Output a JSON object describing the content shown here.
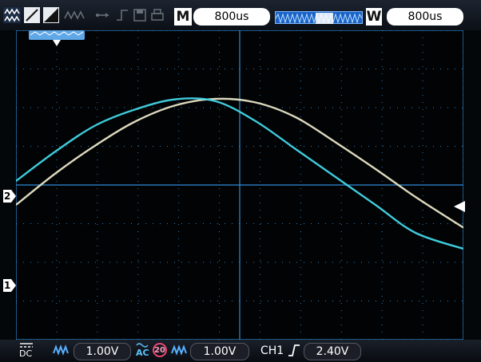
{
  "top": {
    "time_base_letter": "M",
    "time_base_value": "800us",
    "window_letter": "W",
    "window_value": "800us"
  },
  "channels": {
    "ch1_marker": "1",
    "ch2_marker": "2"
  },
  "bottom": {
    "ch1_coupling": "DC",
    "ch1_scale": "1.00V",
    "ch2_coupling_ac": "AC",
    "ch2_bw_label": "20",
    "ch2_scale": "1.00V",
    "trigger_source": "CH1",
    "trigger_level": "2.40V"
  },
  "colors": {
    "grid": "#2f8ad6",
    "trace_ch1": "#e8e5c8",
    "trace_ch2": "#42d6e8",
    "accent": "#2f6bd8"
  },
  "chart_data": {
    "type": "line",
    "xlabel": "",
    "ylabel": "",
    "xlim": [
      -5.6,
      5.6
    ],
    "ylim": [
      -3.88,
      3.88
    ],
    "grid": true,
    "series": [
      {
        "x": [
          -5.6,
          -4.6,
          -3.6,
          -2.6,
          -1.6,
          -0.6,
          0.4,
          1.4,
          2.4,
          3.4,
          4.4,
          5.6
        ],
        "y": [
          -0.5,
          0.3,
          1.0,
          1.6,
          2.0,
          2.16,
          2.07,
          1.7,
          1.07,
          0.4,
          -0.3,
          -1.07
        ]
      },
      {
        "x": [
          -5.6,
          -4.6,
          -3.6,
          -2.6,
          -1.6,
          -0.6,
          0.4,
          1.4,
          2.4,
          3.4,
          4.4,
          5.6
        ],
        "y": [
          0.1,
          0.85,
          1.5,
          1.9,
          2.15,
          2.1,
          1.6,
          0.9,
          0.2,
          -0.5,
          -1.2,
          -1.6
        ]
      }
    ]
  }
}
